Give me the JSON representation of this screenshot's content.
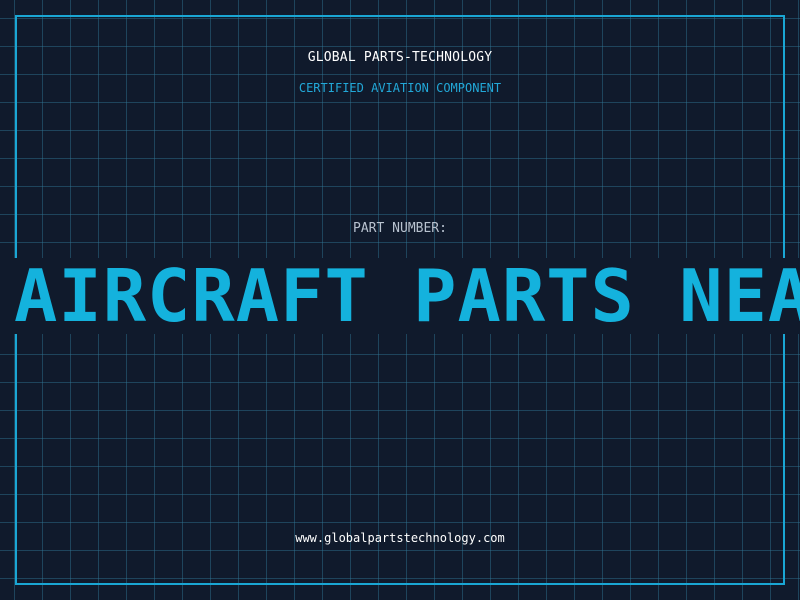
{
  "header": {
    "company": "GLOBAL PARTS-TECHNOLOGY",
    "tagline": "CERTIFIED AVIATION COMPONENT"
  },
  "part": {
    "label": "PART NUMBER:",
    "value": "AIRCRAFT PARTS NEA"
  },
  "footer": {
    "url": "www.globalpartstechnology.com"
  },
  "colors": {
    "background": "#101a2c",
    "grid": "#307896",
    "frame": "#1aa6d4",
    "accent": "#14b2dd",
    "label": "#b8c2cf",
    "text": "#ffffff"
  }
}
